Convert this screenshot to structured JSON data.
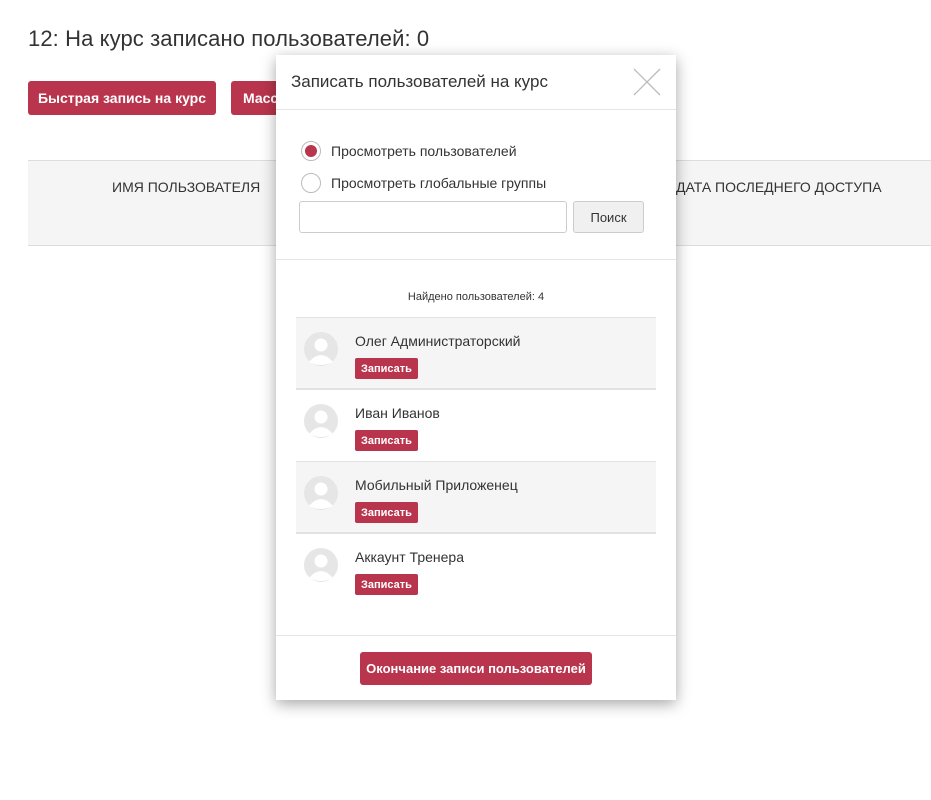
{
  "page": {
    "title": "12: На курс записано пользователей: 0",
    "buttons": {
      "quick_enroll": "Быстрая запись на курс",
      "mass_enroll": "Массовая запись"
    },
    "table_headers": {
      "username": "ИМЯ ПОЛЬЗОВАТЕЛЯ",
      "last_access": "ДАТА ПОСЛЕДНЕГО ДОСТУПА"
    }
  },
  "modal": {
    "title": "Записать пользователей на курс",
    "radio_options": [
      {
        "label": "Просмотреть пользователей",
        "checked": true
      },
      {
        "label": "Просмотреть глобальные группы",
        "checked": false
      }
    ],
    "search": {
      "value": "",
      "placeholder": "",
      "button_label": "Поиск"
    },
    "found_text": "Найдено пользователей: 4",
    "users": [
      {
        "name": "Олег Администраторский",
        "enroll_label": "Записать"
      },
      {
        "name": "Иван Иванов",
        "enroll_label": "Записать"
      },
      {
        "name": "Мобильный Приложенец",
        "enroll_label": "Записать"
      },
      {
        "name": "Аккаунт Тренера",
        "enroll_label": "Записать"
      }
    ],
    "finish_label": "Окончание записи пользователей"
  },
  "colors": {
    "accent": "#b9354d",
    "header_bg": "#f5f5f5",
    "row_shade": "#f5f5f5"
  }
}
